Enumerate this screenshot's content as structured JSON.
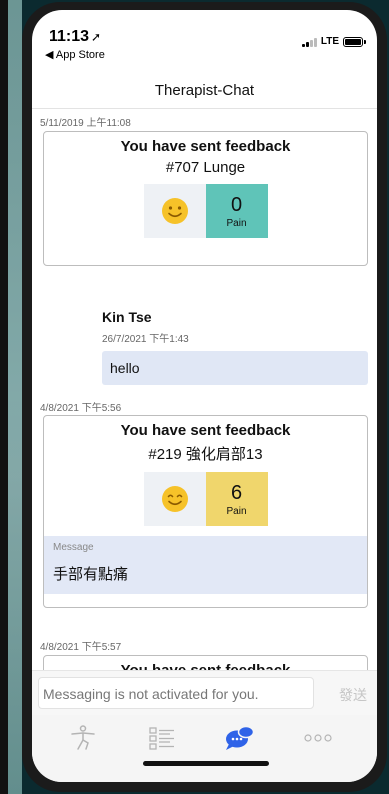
{
  "status_bar": {
    "time": "11:13",
    "location_arrow": "➚",
    "back_app": "◀ App Store",
    "network": "LTE"
  },
  "header": {
    "title": "Therapist-Chat"
  },
  "messages": [
    {
      "timestamp": "5/11/2019 上午11:08",
      "card_title": "You have sent feedback",
      "exercise": "#707 Lunge",
      "pain_value": "0",
      "pain_label": "Pain",
      "pain_color": "#5fc4b8"
    },
    {
      "sender": "Kin Tse",
      "timestamp": "26/7/2021 下午1:43",
      "text": "hello"
    },
    {
      "timestamp": "4/8/2021 下午5:56",
      "card_title": "You have sent feedback",
      "exercise": "#219 強化肩部13",
      "pain_value": "6",
      "pain_label": "Pain",
      "pain_color": "#f0d66c",
      "message_label": "Message",
      "message_text": "手部有點痛"
    },
    {
      "timestamp": "4/8/2021 下午5:57",
      "card_title": "You have sent feedback"
    }
  ],
  "composer": {
    "placeholder": "Messaging is not activated for you.",
    "send_label": "發送"
  },
  "tabs": [
    {
      "icon": "exercise-person-icon",
      "active": false
    },
    {
      "icon": "list-icon",
      "active": false
    },
    {
      "icon": "chat-bubbles-icon",
      "active": true
    },
    {
      "icon": "more-dots-icon",
      "active": false
    }
  ],
  "colors": {
    "accent": "#2f63e8",
    "inactive_icon": "#b4b4b4",
    "bubble": "#e0e7f5",
    "smiley": "#f6c229"
  }
}
